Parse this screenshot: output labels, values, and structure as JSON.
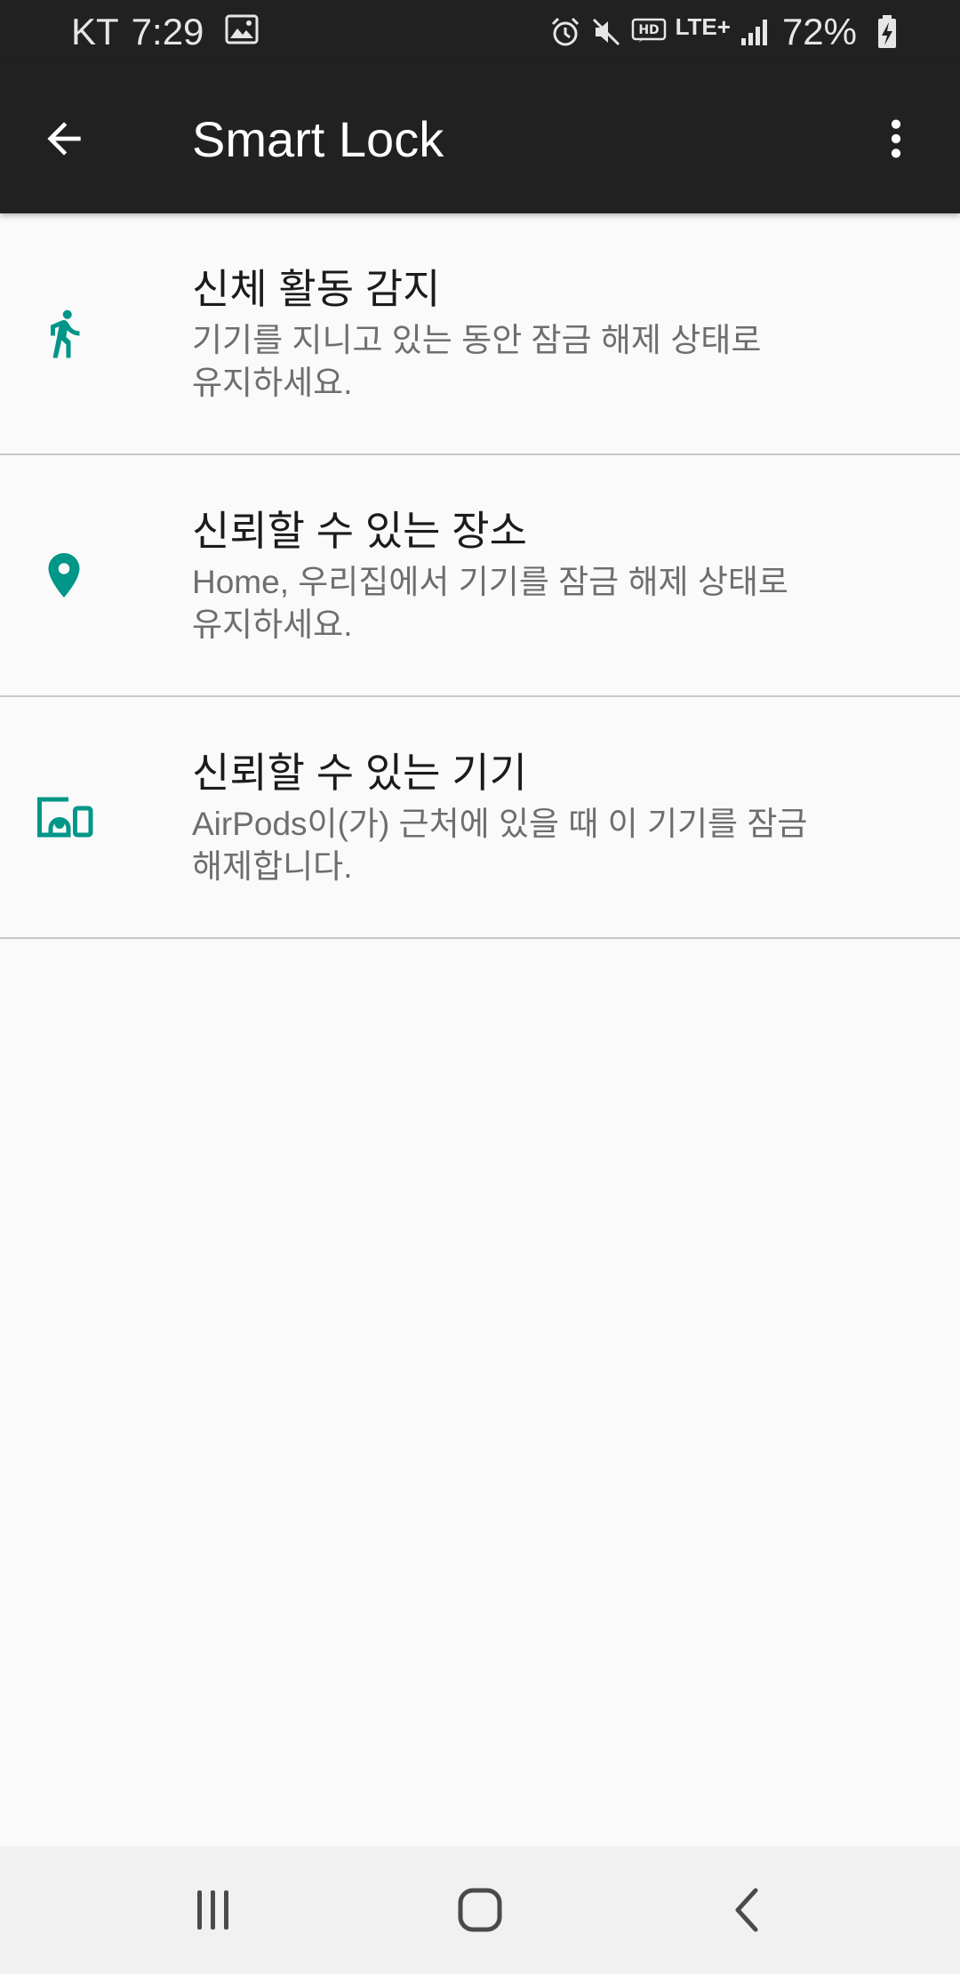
{
  "status_bar": {
    "carrier": "KT",
    "time": "7:29",
    "network_type": "LTE+",
    "battery_percent": "72%",
    "icons": [
      "gallery-icon",
      "alarm-icon",
      "mute-icon",
      "hd-voice-icon",
      "lte-icon",
      "signal-icon",
      "battery-charging-icon"
    ]
  },
  "app_bar": {
    "title": "Smart Lock",
    "back_icon": "arrow-back-icon",
    "menu_icon": "more-vert-icon"
  },
  "theme": {
    "accent": "#009688",
    "app_bar_bg": "#212121",
    "background": "#fafafa",
    "divider": "#c8c8c8"
  },
  "list": {
    "items": [
      {
        "icon": "walking-person-icon",
        "title": "신체 활동 감지",
        "desc_line1": "기기를 지니고 있는 동안 잠금 해제 상태로",
        "desc_line2": "유지하세요."
      },
      {
        "icon": "location-pin-icon",
        "title": "신뢰할 수 있는 장소",
        "desc_line1": "Home, 우리집에서 기기를 잠금 해제 상태로",
        "desc_line2": "유지하세요."
      },
      {
        "icon": "devices-icon",
        "title": "신뢰할 수 있는 기기",
        "desc_line1": "AirPods이(가) 근처에 있을 때 이 기기를 잠금",
        "desc_line2": "해제합니다."
      }
    ]
  },
  "nav_bar": {
    "icons": [
      "recent-apps-icon",
      "home-icon",
      "back-icon"
    ]
  }
}
